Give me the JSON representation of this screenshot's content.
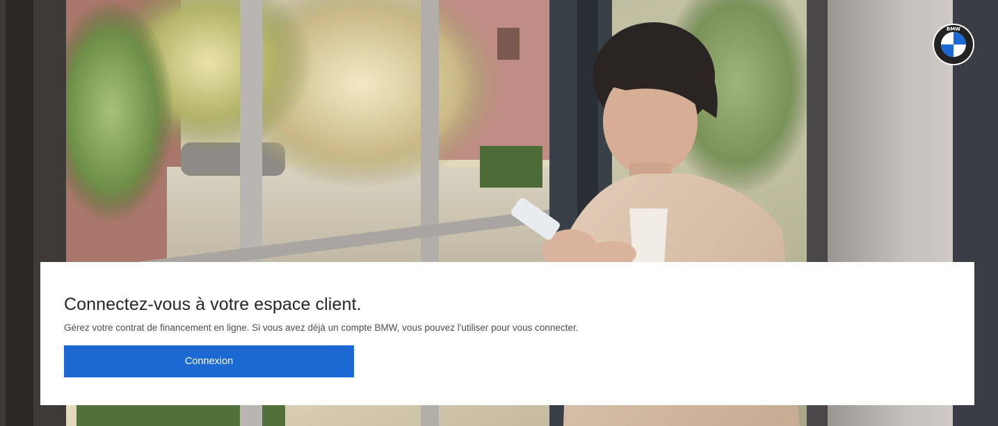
{
  "brand": {
    "logo_icon": "bmw-roundel-icon",
    "logo_text": "BMW",
    "roundel_blue": "#1c69d4"
  },
  "hero": {
    "image_icon": "woman-at-window-with-phone-photo"
  },
  "login_card": {
    "title": "Connectez-vous à votre espace client.",
    "description": "Gérez votre contrat de financement en ligne. Si vous avez déjà un compte BMW, vous pouvez l'utiliser pour vous connecter.",
    "button_label": "Connexion",
    "button_color": "#1c69d4"
  }
}
